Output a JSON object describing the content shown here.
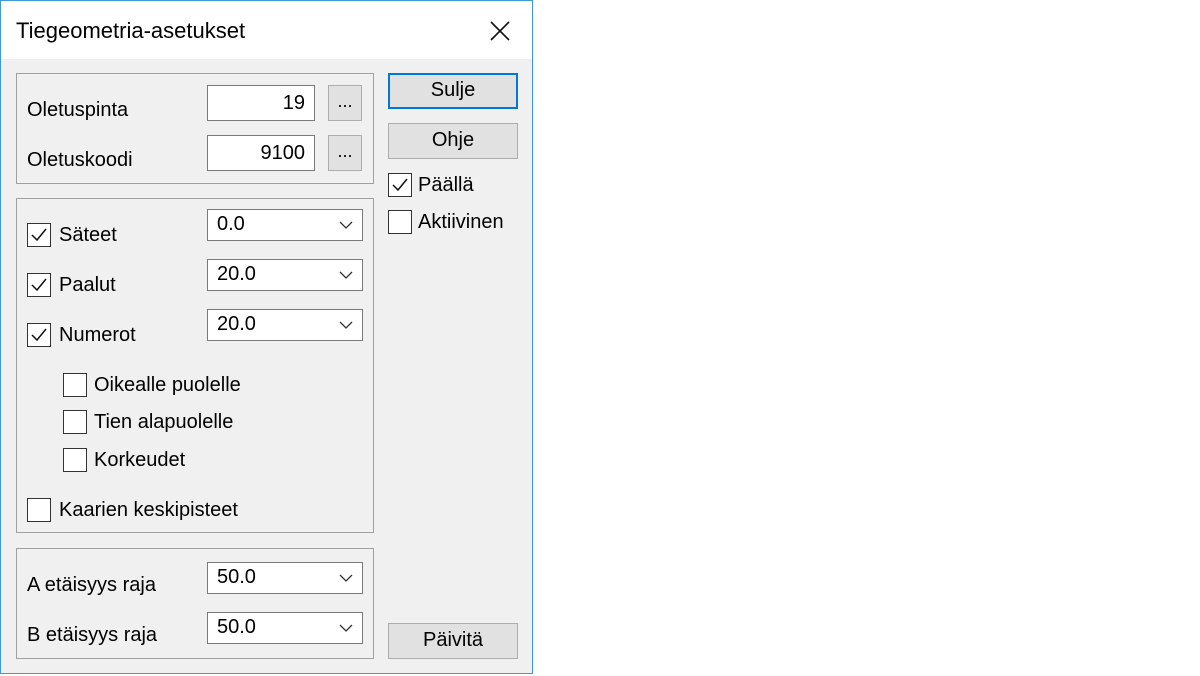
{
  "window": {
    "title": "Tiegeometria-asetukset"
  },
  "defaults": {
    "surface_label": "Oletuspinta",
    "surface_value": "19",
    "code_label": "Oletuskoodi",
    "code_value": "9100",
    "browse_label": "..."
  },
  "display": {
    "radii": {
      "label": "Säteet",
      "checked": true,
      "value": "0.0"
    },
    "stations": {
      "label": "Paalut",
      "checked": true,
      "value": "20.0"
    },
    "numbers": {
      "label": "Numerot",
      "checked": true,
      "value": "20.0"
    },
    "right_side": {
      "label": "Oikealle puolelle",
      "checked": false
    },
    "below_road": {
      "label": "Tien alapuolelle",
      "checked": false
    },
    "elevations": {
      "label": "Korkeudet",
      "checked": false
    },
    "arc_midpoints": {
      "label": "Kaarien keskipisteet",
      "checked": false
    }
  },
  "distance": {
    "a_label": "A etäisyys raja",
    "a_value": "50.0",
    "b_label": "B etäisyys raja",
    "b_value": "50.0"
  },
  "buttons": {
    "close": "Sulje",
    "help": "Ohje",
    "refresh": "Päivitä"
  },
  "options": {
    "on": {
      "label": "Päällä",
      "checked": true
    },
    "active": {
      "label": "Aktiivinen",
      "checked": false
    }
  },
  "icons": {
    "close": "close-icon",
    "check": "checkmark-icon",
    "dropdown": "chevron-down-icon"
  }
}
